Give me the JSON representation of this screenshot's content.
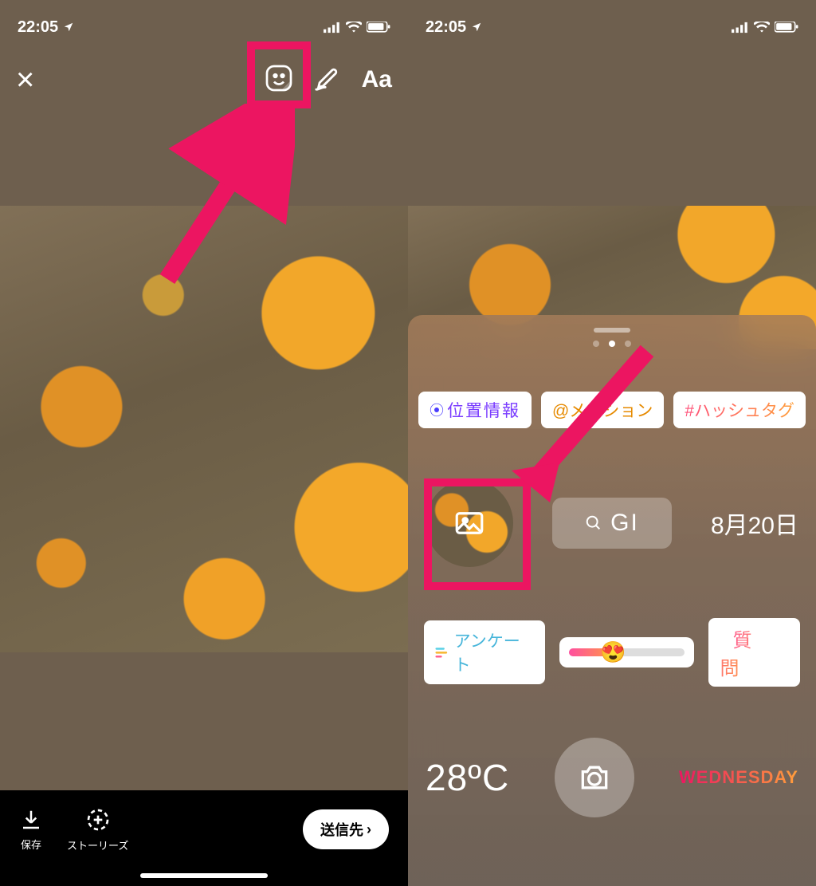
{
  "status": {
    "time": "22:05",
    "location_arrow": "↗"
  },
  "left": {
    "topbar": {
      "text_label": "Aa"
    },
    "bottom": {
      "save": "保存",
      "stories": "ストーリーズ",
      "send": "送信先"
    }
  },
  "right": {
    "stickers": {
      "location": "位置情報",
      "mention_visible": "@メ　ション",
      "hashtag": "#ハッシュタグ",
      "gif": "GI",
      "date": "8月20日",
      "poll": "アンケート",
      "question": "質問",
      "temperature": "28",
      "temperature_unit": "ºC",
      "day": "WEDNESDAY"
    }
  },
  "highlight_color": "#ec1561"
}
